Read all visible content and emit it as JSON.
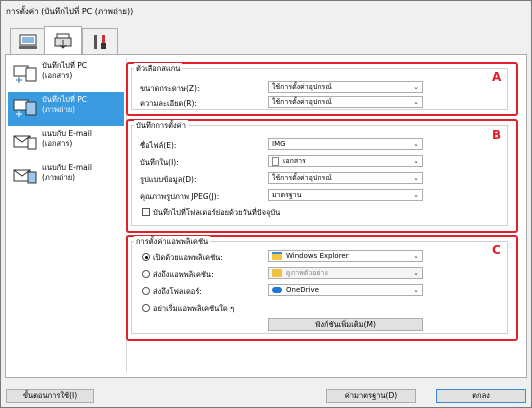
{
  "window": {
    "title": "การตั้งค่า (บันทึกไปที่ PC (ภาพถ่าย))"
  },
  "tabs": [
    {
      "name": "scan-from-computer"
    },
    {
      "name": "scan-from-operation-panel"
    },
    {
      "name": "general-settings"
    }
  ],
  "sidebar": {
    "items": [
      {
        "label": "บันทึกไปที่ PC\n(เอกสาร)",
        "active": false
      },
      {
        "label": "บันทึกไปที่ PC\n(ภาพถ่าย)",
        "active": true
      },
      {
        "label": "แนบกับ E-mail\n(เอกสาร)",
        "active": false
      },
      {
        "label": "แนบกับ E-mail\n(ภาพถ่าย)",
        "active": false
      }
    ]
  },
  "sections": {
    "scan_options": {
      "title": "ตัวเลือกสแกน",
      "letter": "A",
      "rows": [
        {
          "label": "ขนาดกระดาษ(Z):",
          "value": "ใช้การตั้งค่าอุปกรณ์"
        },
        {
          "label": "ความละเอียด(R):",
          "value": "ใช้การตั้งค่าอุปกรณ์"
        }
      ]
    },
    "save_settings": {
      "title": "บันทึกการตั้งค่า",
      "letter": "B",
      "rows": [
        {
          "label": "ชื่อไฟล์(E):",
          "value": "IMG",
          "kind": "input"
        },
        {
          "label": "บันทึกใน(I):",
          "value": "เอกสาร",
          "kind": "select-doc"
        },
        {
          "label": "รูปแบบข้อมูล(D):",
          "value": "ใช้การตั้งค่าอุปกรณ์",
          "kind": "select"
        },
        {
          "label": "คุณภาพรูปภาพ JPEG(J):",
          "value": "มาตรฐาน",
          "kind": "select"
        }
      ],
      "checkbox_label": "บันทึกไปที่โฟลเดอร์ย่อยด้วยวันที่ปัจจุบัน"
    },
    "app_settings": {
      "title": "การตั้งค่าแอพพลิเคชัน",
      "letter": "C",
      "options": [
        {
          "label": "เปิดด้วยแอพพลิเคชัน:",
          "value": "Windows Explorer",
          "selected": true,
          "icon": "windows-explorer-icon",
          "disabled": false
        },
        {
          "label": "ส่งถึงแอพพลิเคชัน:",
          "value": "ดูภาพตัวอย่าง",
          "selected": false,
          "icon": "folder-icon",
          "disabled": true
        },
        {
          "label": "ส่งถึงโฟลเดอร์:",
          "value": "OneDrive",
          "selected": false,
          "icon": "onedrive-icon",
          "disabled": false
        },
        {
          "label": "อย่าเริ่มแอพพลิเคชันใด ๆ",
          "value": "",
          "selected": false,
          "icon": "",
          "disabled": false
        }
      ],
      "more_functions_label": "ฟังก์ชันเพิ่มเติม(M)"
    }
  },
  "footer": {
    "instructions_label": "ขั้นตอนการใช้(I)",
    "defaults_label": "ค่ามาตรฐาน(D)",
    "ok_label": "ตกลง"
  },
  "colors": {
    "highlight_frame": "#e0202b",
    "active_item": "#3a9be0"
  }
}
